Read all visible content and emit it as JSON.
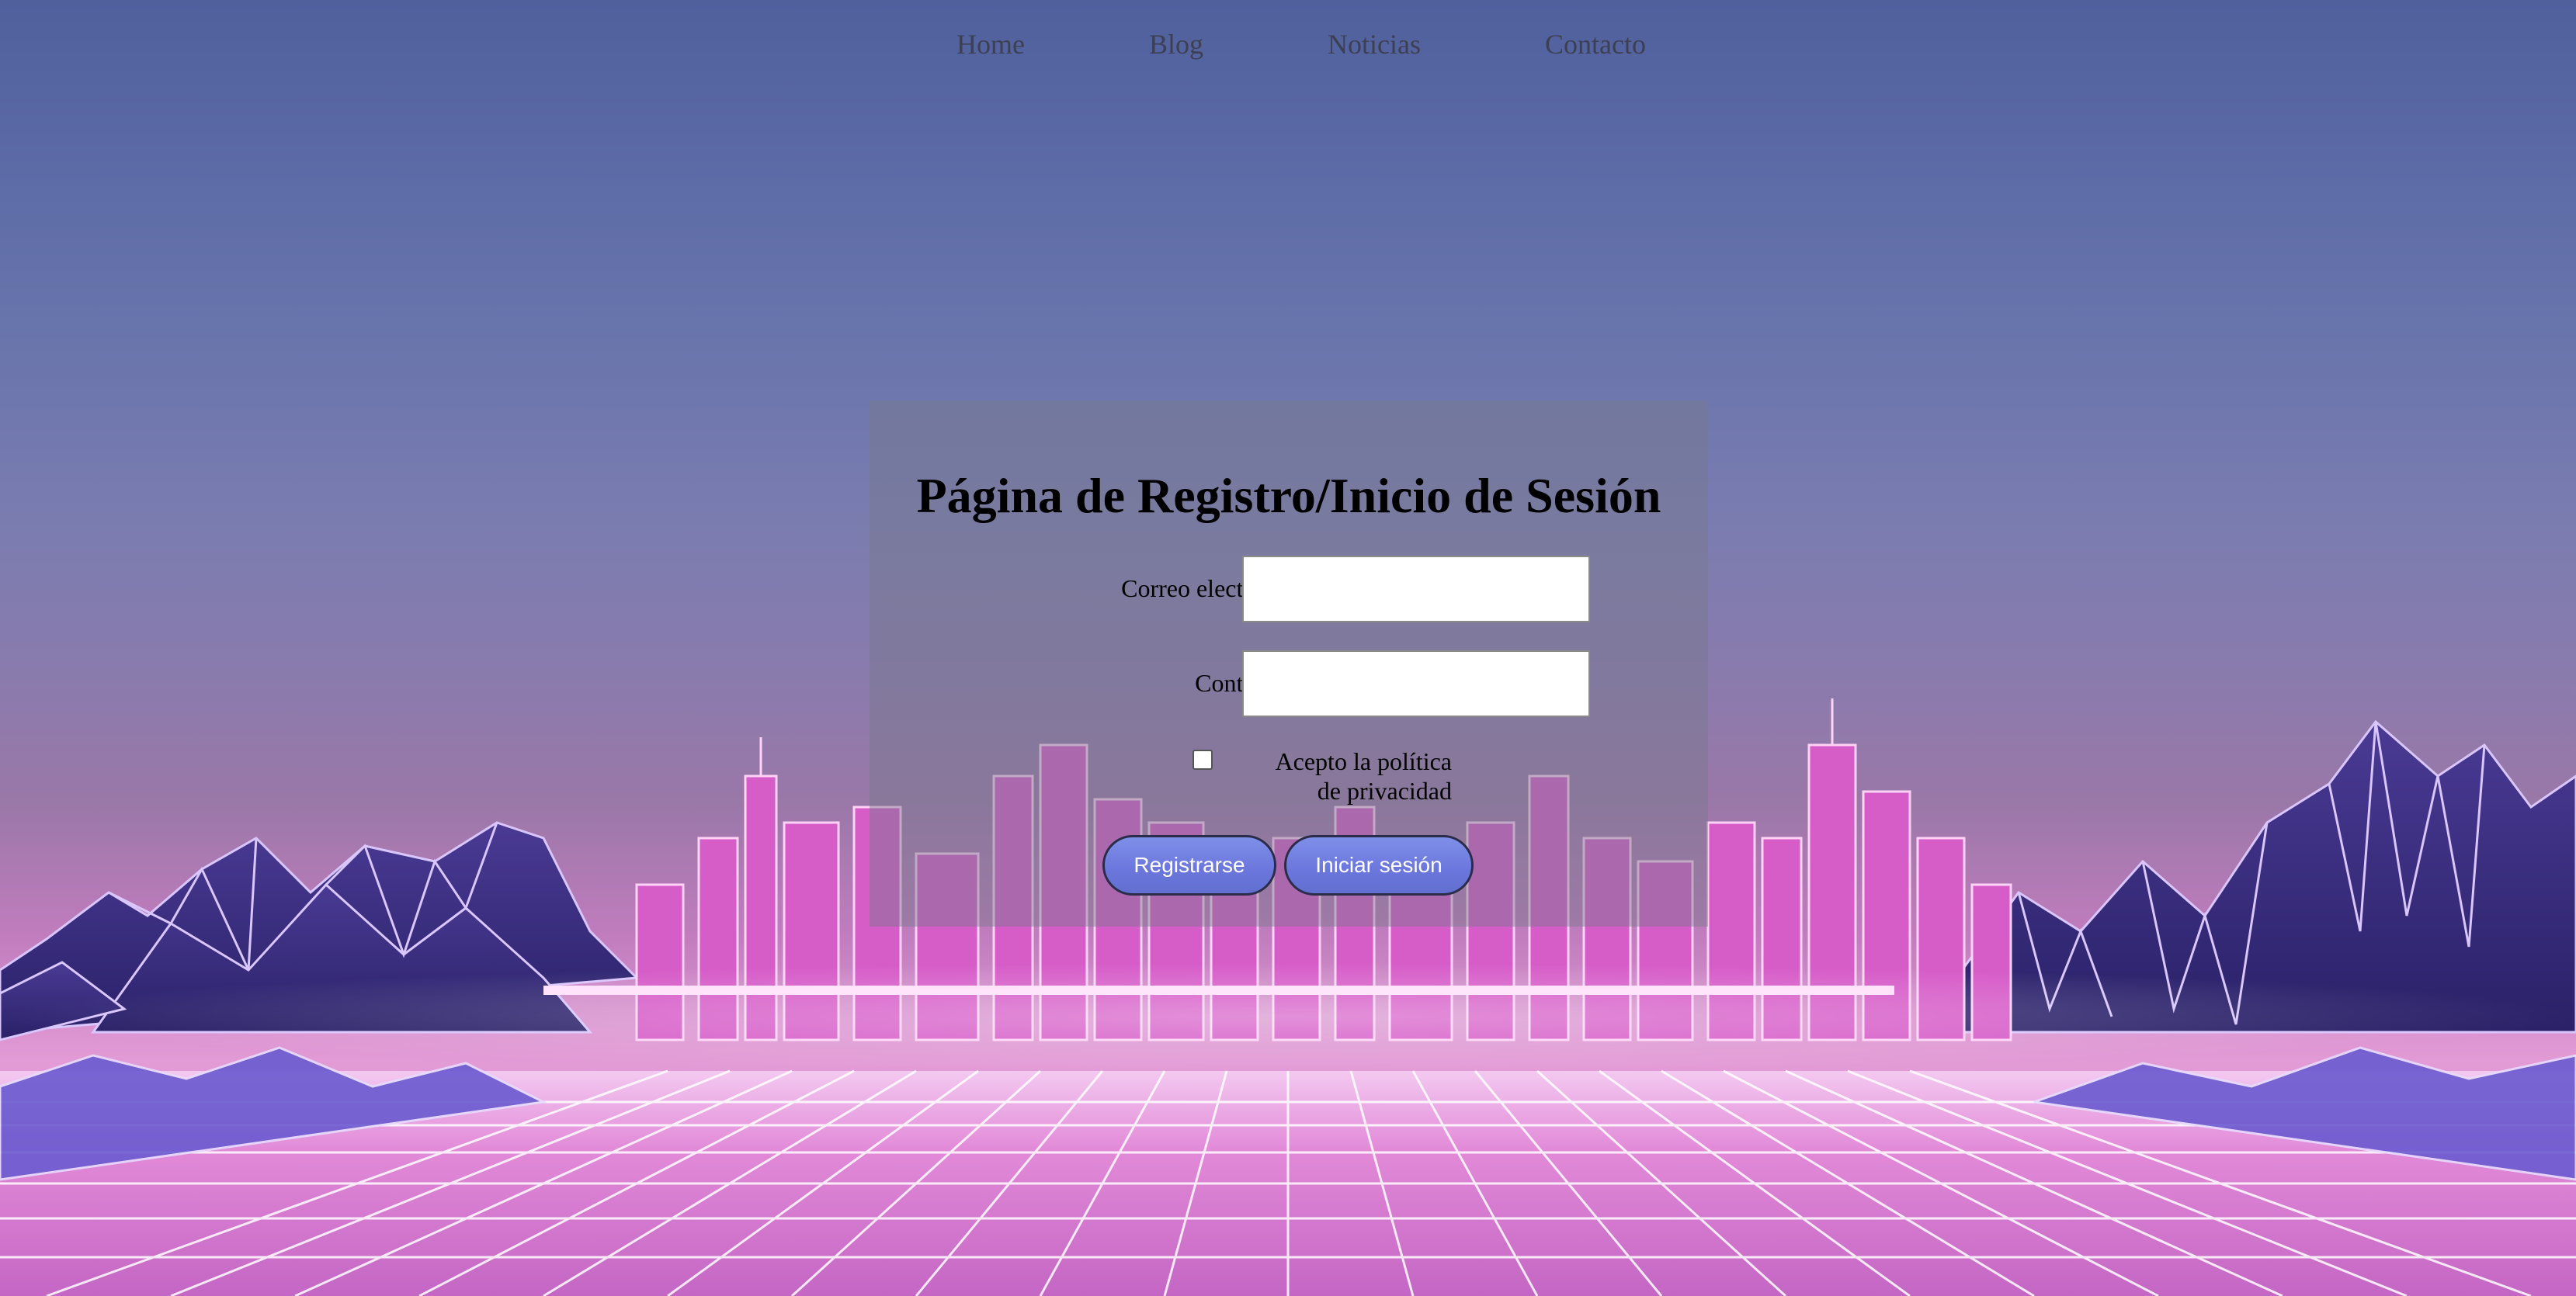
{
  "nav": {
    "items": [
      {
        "label": "Home"
      },
      {
        "label": "Blog"
      },
      {
        "label": "Noticias"
      },
      {
        "label": "Contacto"
      }
    ]
  },
  "form": {
    "title": "Página de Registro/Inicio de Sesión",
    "email_label": "Correo electrónico:",
    "email_value": "",
    "password_label": "Contraseña:",
    "password_value": "",
    "privacy_checked": false,
    "privacy_label_line1": "Acepto la política",
    "privacy_label_line2": "de privacidad",
    "register_label": "Registrarse",
    "login_label": "Iniciar sesión"
  },
  "colors": {
    "sky_top": "#4f609d",
    "city_neon": "#e05cd0",
    "mountains": "#3b2f7a",
    "grid_lines": "#ffffff",
    "button": "#6b76dc"
  }
}
